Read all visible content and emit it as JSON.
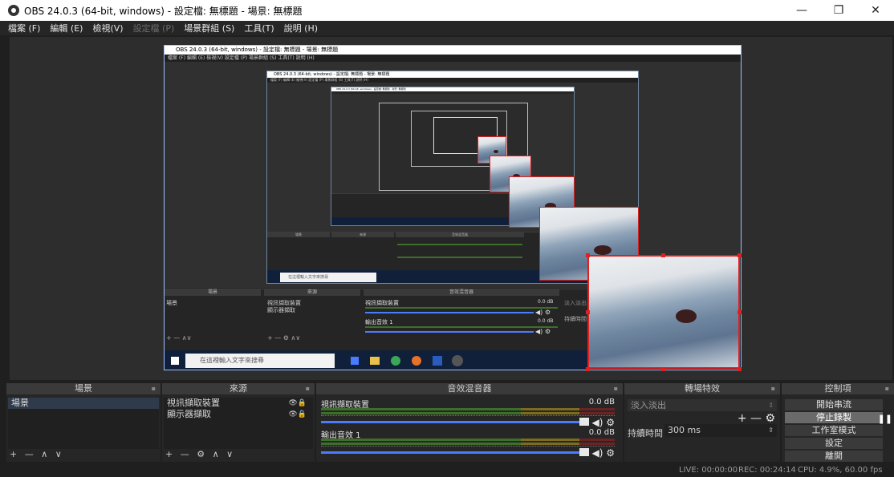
{
  "window": {
    "title": "OBS 24.0.3 (64-bit, windows) - 設定檔: 無標題 - 場景: 無標題",
    "minimize": "—",
    "maximize": "❐",
    "close": "✕"
  },
  "menu": [
    {
      "label": "檔案 (F)",
      "enabled": true
    },
    {
      "label": "編輯 (E)",
      "enabled": true
    },
    {
      "label": "檢視(V)",
      "enabled": true
    },
    {
      "label": "設定檔 (P)",
      "enabled": false
    },
    {
      "label": "場景群組 (S)",
      "enabled": true
    },
    {
      "label": "工具(T)",
      "enabled": true
    },
    {
      "label": "說明 (H)",
      "enabled": true
    }
  ],
  "nested": {
    "title": "OBS 24.0.3 (64-bit, windows) - 設定檔: 無標題 - 場景: 無標題",
    "menu": "檔案 (F)  編輯 (E)  檢視(V)  設定檔 (P)  場景群組 (S)  工具(T)  說明 (H)",
    "scenes_header": "場景",
    "sources_header": "來源",
    "mixer_header": "音效混音器",
    "scene_item": "場景",
    "source_1": "視訊擷取裝置",
    "source_2": "顯示器擷取",
    "channel_1": "視訊擷取裝置",
    "channel_2": "輸出音效 1",
    "db": "0.0 dB",
    "trans_item": "淡入淡出",
    "duration_label": "持續時間",
    "search_placeholder": "在這裡輸入文字來搜尋",
    "controls": "+ — ∧∨",
    "sources_controls": "+ — ⚙ ∧∨",
    "mixer_icons": "◀) ⚙"
  },
  "scenes": {
    "header": "場景",
    "items": [
      "場景"
    ],
    "tools": "+ — ∧ ∨"
  },
  "sources": {
    "header": "來源",
    "items": [
      {
        "label": "視訊擷取裝置",
        "icons": "👁🔒"
      },
      {
        "label": "顯示器擷取",
        "icons": "👁🔒"
      }
    ],
    "tools": "+ — ⚙ ∧ ∨"
  },
  "mixer": {
    "header": "音效混音器",
    "channels": [
      {
        "name": "視訊擷取裝置",
        "db": "0.0 dB",
        "icons": "◀) ⚙"
      },
      {
        "name": "輸出音效 1",
        "db": "0.0 dB",
        "icons": "◀) ⚙"
      }
    ]
  },
  "transitions": {
    "header": "轉場特效",
    "selected": "淡入淡出",
    "tools": "+ — ⚙",
    "duration_label": "持續時間",
    "duration_value": "300 ms"
  },
  "controls": {
    "header": "控制項",
    "buttons": [
      "開始串流",
      "停止錄製",
      "工作室模式",
      "設定",
      "離開"
    ],
    "pause": "❚❚"
  },
  "status": {
    "live": "LIVE: 00:00:00",
    "rec": "REC: 00:24:14",
    "cpu": "CPU: 4.9%, 60.00 fps"
  },
  "float_icon": "▪"
}
